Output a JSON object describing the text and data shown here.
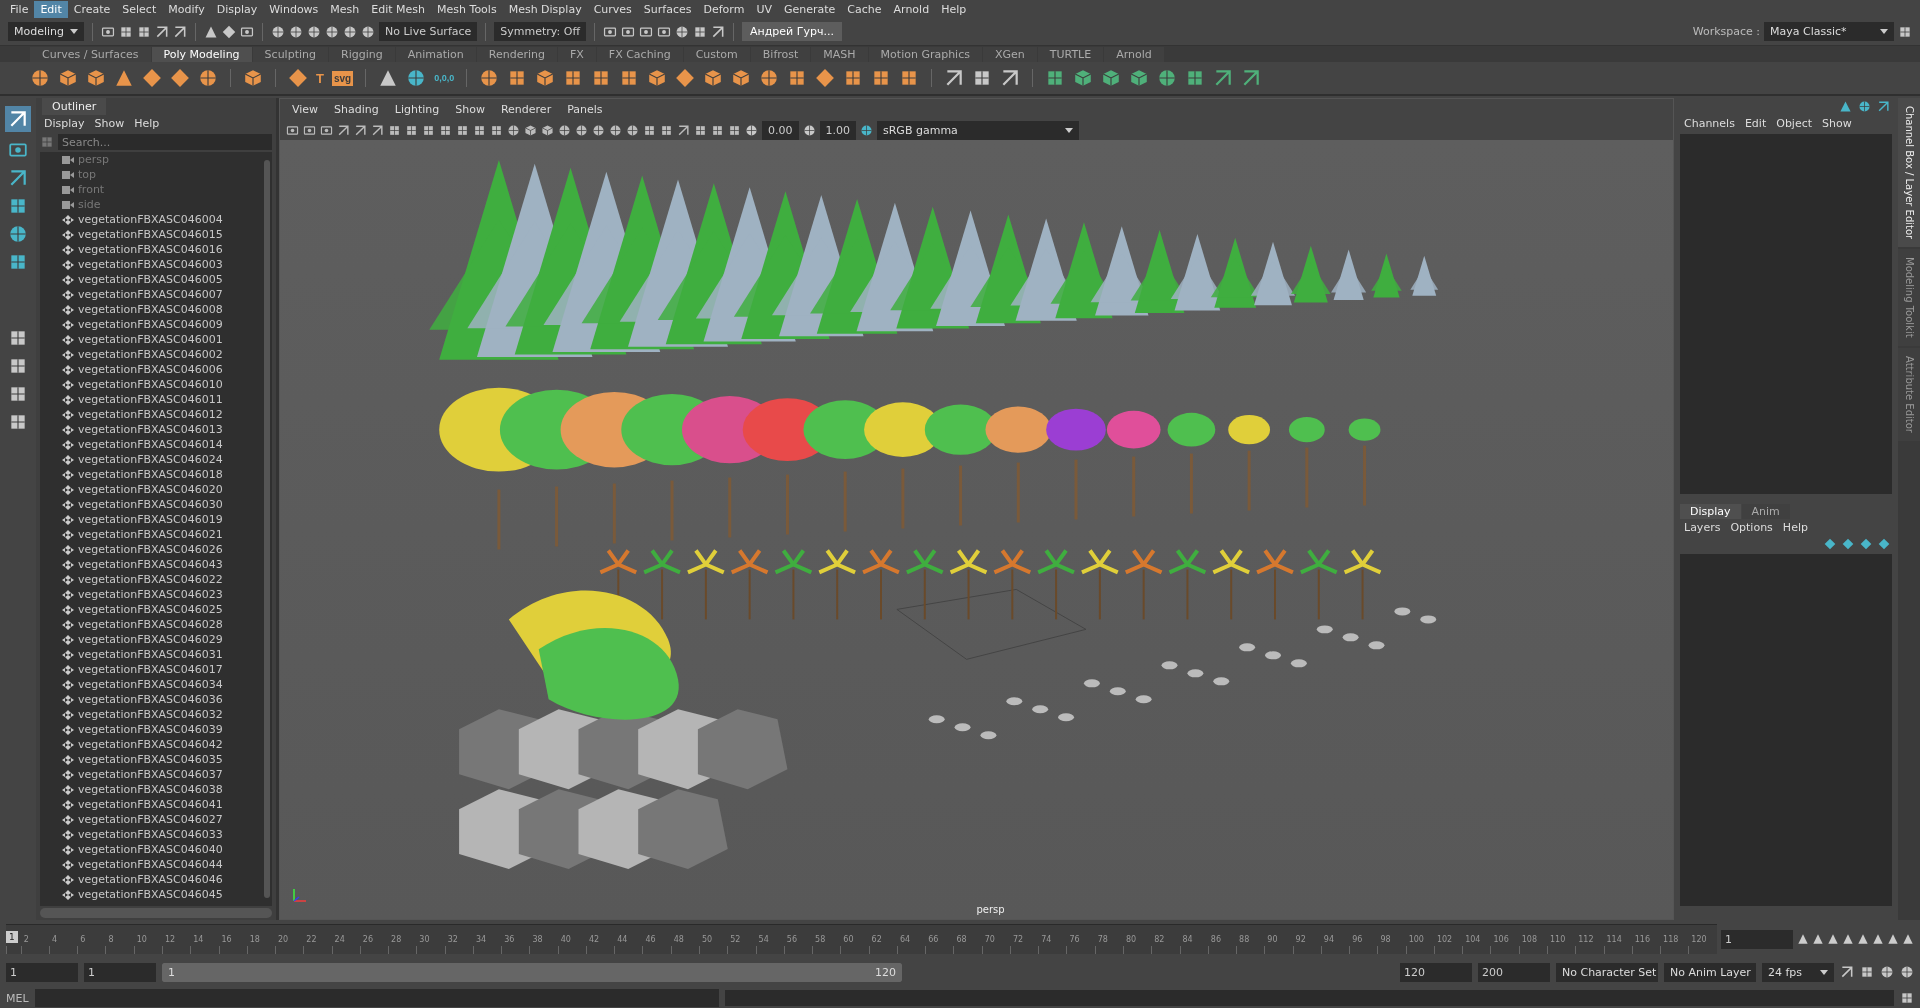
{
  "menu_bar": [
    {
      "label": "File",
      "selected": false
    },
    {
      "label": "Edit",
      "selected": true
    },
    {
      "label": "Create",
      "selected": false
    },
    {
      "label": "Select",
      "selected": false
    },
    {
      "label": "Modify",
      "selected": false
    },
    {
      "label": "Display",
      "selected": false
    },
    {
      "label": "Windows",
      "selected": false
    },
    {
      "label": "Mesh",
      "selected": false
    },
    {
      "label": "Edit Mesh",
      "selected": false
    },
    {
      "label": "Mesh Tools",
      "selected": false
    },
    {
      "label": "Mesh Display",
      "selected": false
    },
    {
      "label": "Curves",
      "selected": false
    },
    {
      "label": "Surfaces",
      "selected": false
    },
    {
      "label": "Deform",
      "selected": false
    },
    {
      "label": "UV",
      "selected": false
    },
    {
      "label": "Generate",
      "selected": false
    },
    {
      "label": "Cache",
      "selected": false
    },
    {
      "label": "Arnold",
      "selected": false
    },
    {
      "label": "Help",
      "selected": false
    }
  ],
  "status_line": {
    "menu_set": "Modeling",
    "live_surface": "No Live Surface",
    "symmetry": "Symmetry: Off",
    "user": "Андрей Гурч...",
    "workspace_label": "Workspace :",
    "workspace": "Maya Classic*"
  },
  "shelf_tabs": [
    {
      "label": "Curves / Surfaces",
      "selected": false
    },
    {
      "label": "Poly Modeling",
      "selected": true
    },
    {
      "label": "Sculpting",
      "selected": false
    },
    {
      "label": "Rigging",
      "selected": false
    },
    {
      "label": "Animation",
      "selected": false
    },
    {
      "label": "Rendering",
      "selected": false
    },
    {
      "label": "FX",
      "selected": false
    },
    {
      "label": "FX Caching",
      "selected": false
    },
    {
      "label": "Custom",
      "selected": false
    },
    {
      "label": "Bifrost",
      "selected": false
    },
    {
      "label": "MASH",
      "selected": false
    },
    {
      "label": "Motion Graphics",
      "selected": false
    },
    {
      "label": "XGen",
      "selected": false
    },
    {
      "label": "TURTLE",
      "selected": false
    },
    {
      "label": "Arnold",
      "selected": false
    }
  ],
  "shelf_text_icons": [
    "T",
    "svg",
    "0,0,0"
  ],
  "outliner": {
    "title": "Outliner",
    "menu": [
      "Display",
      "Show",
      "Help"
    ],
    "search": {
      "placeholder": "Search..."
    },
    "items": [
      {
        "kind": "camera",
        "label": "persp"
      },
      {
        "kind": "camera",
        "label": "top"
      },
      {
        "kind": "camera",
        "label": "front"
      },
      {
        "kind": "camera",
        "label": "side"
      },
      {
        "kind": "transform",
        "label": "vegetationFBXASC046004"
      },
      {
        "kind": "transform",
        "label": "vegetationFBXASC046015"
      },
      {
        "kind": "transform",
        "label": "vegetationFBXASC046016"
      },
      {
        "kind": "transform",
        "label": "vegetationFBXASC046003"
      },
      {
        "kind": "transform",
        "label": "vegetationFBXASC046005"
      },
      {
        "kind": "transform",
        "label": "vegetationFBXASC046007"
      },
      {
        "kind": "transform",
        "label": "vegetationFBXASC046008"
      },
      {
        "kind": "transform",
        "label": "vegetationFBXASC046009"
      },
      {
        "kind": "transform",
        "label": "vegetationFBXASC046001"
      },
      {
        "kind": "transform",
        "label": "vegetationFBXASC046002"
      },
      {
        "kind": "transform",
        "label": "vegetationFBXASC046006"
      },
      {
        "kind": "transform",
        "label": "vegetationFBXASC046010"
      },
      {
        "kind": "transform",
        "label": "vegetationFBXASC046011"
      },
      {
        "kind": "transform",
        "label": "vegetationFBXASC046012"
      },
      {
        "kind": "transform",
        "label": "vegetationFBXASC046013"
      },
      {
        "kind": "transform",
        "label": "vegetationFBXASC046014"
      },
      {
        "kind": "transform",
        "label": "vegetationFBXASC046024"
      },
      {
        "kind": "transform",
        "label": "vegetationFBXASC046018"
      },
      {
        "kind": "transform",
        "label": "vegetationFBXASC046020"
      },
      {
        "kind": "transform",
        "label": "vegetationFBXASC046030"
      },
      {
        "kind": "transform",
        "label": "vegetationFBXASC046019"
      },
      {
        "kind": "transform",
        "label": "vegetationFBXASC046021"
      },
      {
        "kind": "transform",
        "label": "vegetationFBXASC046026"
      },
      {
        "kind": "transform",
        "label": "vegetationFBXASC046043"
      },
      {
        "kind": "transform",
        "label": "vegetationFBXASC046022"
      },
      {
        "kind": "transform",
        "label": "vegetationFBXASC046023"
      },
      {
        "kind": "transform",
        "label": "vegetationFBXASC046025"
      },
      {
        "kind": "transform",
        "label": "vegetationFBXASC046028"
      },
      {
        "kind": "transform",
        "label": "vegetationFBXASC046029"
      },
      {
        "kind": "transform",
        "label": "vegetationFBXASC046031"
      },
      {
        "kind": "transform",
        "label": "vegetationFBXASC046017"
      },
      {
        "kind": "transform",
        "label": "vegetationFBXASC046034"
      },
      {
        "kind": "transform",
        "label": "vegetationFBXASC046036"
      },
      {
        "kind": "transform",
        "label": "vegetationFBXASC046032"
      },
      {
        "kind": "transform",
        "label": "vegetationFBXASC046039"
      },
      {
        "kind": "transform",
        "label": "vegetationFBXASC046042"
      },
      {
        "kind": "transform",
        "label": "vegetationFBXASC046035"
      },
      {
        "kind": "transform",
        "label": "vegetationFBXASC046037"
      },
      {
        "kind": "transform",
        "label": "vegetationFBXASC046038"
      },
      {
        "kind": "transform",
        "label": "vegetationFBXASC046041"
      },
      {
        "kind": "transform",
        "label": "vegetationFBXASC046027"
      },
      {
        "kind": "transform",
        "label": "vegetationFBXASC046033"
      },
      {
        "kind": "transform",
        "label": "vegetationFBXASC046040"
      },
      {
        "kind": "transform",
        "label": "vegetationFBXASC046044"
      },
      {
        "kind": "transform",
        "label": "vegetationFBXASC046046"
      },
      {
        "kind": "transform",
        "label": "vegetationFBXASC046045"
      }
    ]
  },
  "viewport": {
    "menu": [
      "View",
      "Shading",
      "Lighting",
      "Show",
      "Renderer",
      "Panels"
    ],
    "exposure": "0.00",
    "gamma": "1.00",
    "color_space": "sRGB gamma",
    "camera_label": "persp"
  },
  "channel_box": {
    "menu": [
      "Channels",
      "Edit",
      "Object",
      "Show"
    ]
  },
  "layer_editor": {
    "tabs": [
      {
        "label": "Display",
        "selected": true
      },
      {
        "label": "Anim",
        "selected": false
      }
    ],
    "menu": [
      "Layers",
      "Options",
      "Help"
    ]
  },
  "side_tabs": [
    {
      "label": "Channel Box / Layer Editor",
      "selected": true
    },
    {
      "label": "Modeling Toolkit",
      "selected": false
    },
    {
      "label": "Attribute Editor",
      "selected": false
    }
  ],
  "timeline": {
    "current_frame": "1",
    "level": 0,
    "ticks": [
      "2",
      "4",
      "6",
      "8",
      "10",
      "12",
      "14",
      "16",
      "18",
      "20",
      "22",
      "24",
      "26",
      "28",
      "30",
      "32",
      "34",
      "36",
      "38",
      "40",
      "42",
      "44",
      "46",
      "48",
      "50",
      "52",
      "54",
      "56",
      "58",
      "60",
      "62",
      "64",
      "66",
      "68",
      "70",
      "72",
      "74",
      "76",
      "78",
      "80",
      "82",
      "84",
      "86",
      "88",
      "90",
      "92",
      "94",
      "96",
      "98",
      "100",
      "102",
      "104",
      "106",
      "108",
      "110",
      "112",
      "114",
      "116",
      "118",
      "120"
    ],
    "frame_field": "1"
  },
  "range": {
    "start": "1",
    "range_start": "1",
    "slider_start": "1",
    "slider_end": "120",
    "level": 1,
    "range_end": "120",
    "end": "200",
    "character_set": "No Character Set",
    "anim_layer": "No Anim Layer",
    "fps": "24 fps"
  },
  "command_line": {
    "language": "MEL"
  }
}
